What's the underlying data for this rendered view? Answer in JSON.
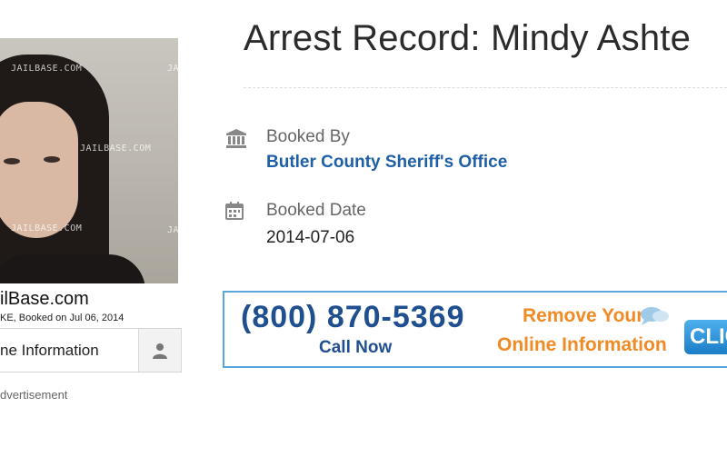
{
  "photo": {
    "watermark": "JAILBASE.COM"
  },
  "sidebar": {
    "site_caption": "ilBase.com",
    "booking_caption": "KE,  Booked on Jul 06, 2014",
    "remove_button_label": "ne Information",
    "remove_button_icon": "user-icon",
    "ad_label": "dvertisement"
  },
  "record": {
    "title": "Arrest Record: Mindy Ashte",
    "booked_by_label": "Booked By",
    "booked_by_value": "Butler County Sheriff's Office",
    "booked_by_icon": "courthouse-icon",
    "booked_date_label": "Booked Date",
    "booked_date_value": "2014-07-06",
    "booked_date_icon": "calendar-icon"
  },
  "banner": {
    "phone": "(800) 870-5369",
    "call_now": "Call Now",
    "remove_line1": "Remove Your",
    "remove_line2": "Online Information",
    "click_label": "CLIC",
    "bubble_icon": "speech-bubble-icon"
  },
  "colors": {
    "link": "#1f5fa8",
    "banner_border": "#5aa6dc",
    "banner_blue": "#1f4f8f",
    "banner_orange": "#f08a24"
  }
}
